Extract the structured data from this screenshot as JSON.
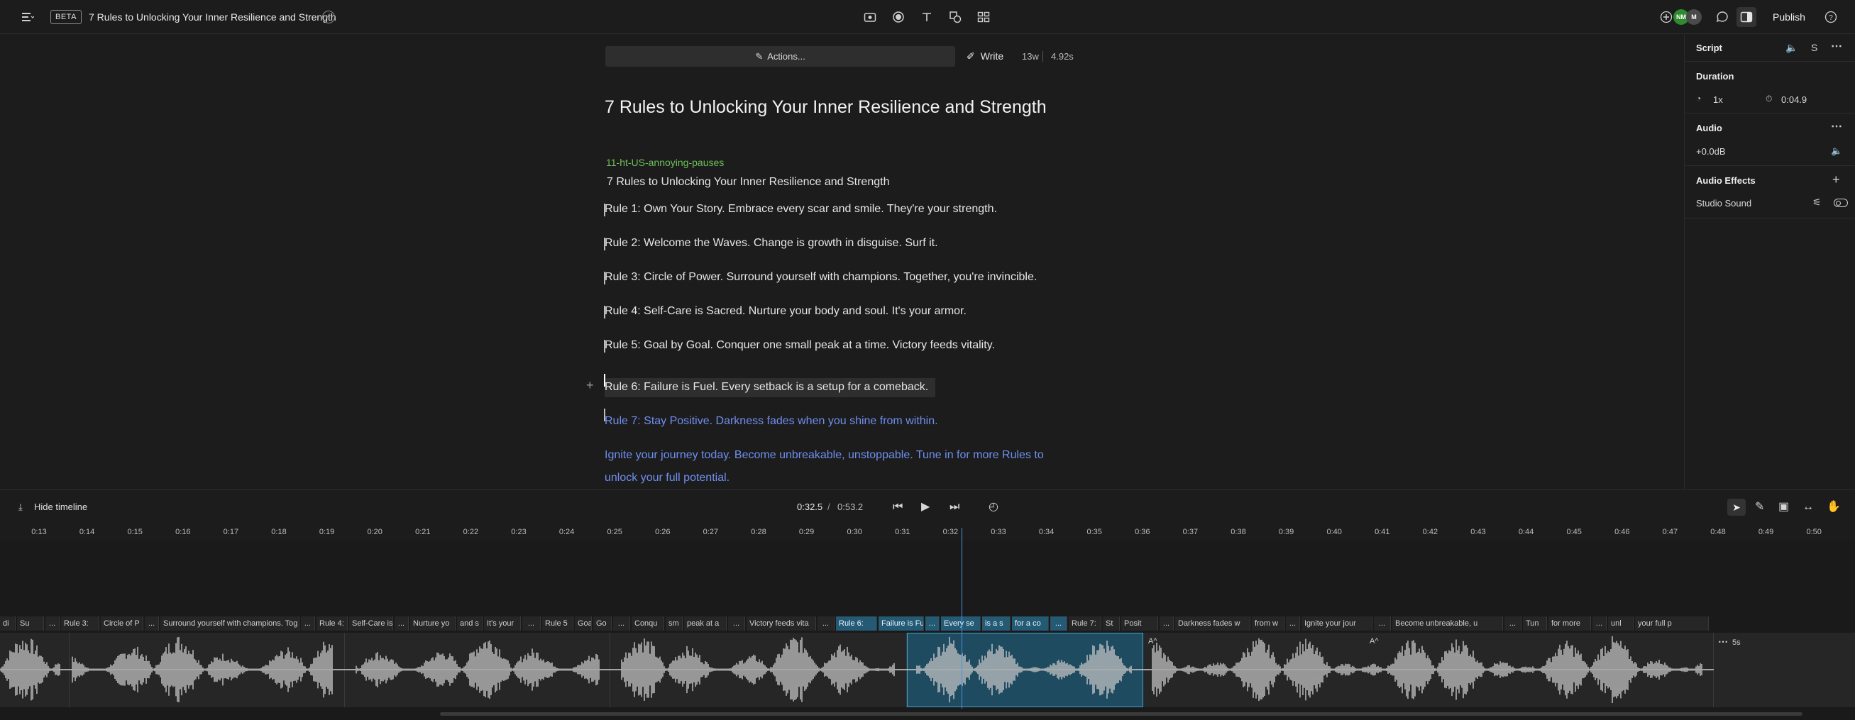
{
  "topbar": {
    "beta_label": "BETA",
    "title": "7 Rules to Unlocking Your Inner Resilience and Strength",
    "avatars": [
      {
        "initials": "NM",
        "color": "#2e8b2e"
      },
      {
        "initials": "M",
        "color": "#4a4a4a"
      }
    ],
    "publish_label": "Publish"
  },
  "editor": {
    "actions_label": "Actions...",
    "write_label": "Write",
    "word_count": "13w",
    "duration": "4.92s",
    "heading": "7 Rules to Unlocking Your Inner Resilience and Strength",
    "speaker": "11-ht-US-annoying-pauses",
    "lines": [
      "7 Rules to Unlocking Your Inner Resilience and Strength",
      "Rule 1: Own Your Story. Embrace every scar and smile. They're your strength.",
      "Rule 2: Welcome the Waves. Change is growth in disguise. Surf it.",
      "Rule 3: Circle of Power. Surround yourself with champions. Together, you're invincible.",
      "Rule 4: Self-Care is Sacred. Nurture your body and soul. It's your armor.",
      "Rule 5: Goal by Goal. Conquer one small peak at a time. Victory feeds vitality.",
      "Rule 6: Failure is Fuel. Every setback is a setup for a comeback.",
      "Rule 7: Stay Positive. Darkness fades when you shine from within.",
      "Ignite your journey today. Become unbreakable, unstoppable. Tune in for more Rules to",
      "unlock your full potential."
    ]
  },
  "panel": {
    "script_label": "Script",
    "script_shortcut": "S",
    "duration_label": "Duration",
    "speed": "1x",
    "duration_value": "0:04.9",
    "audio_label": "Audio",
    "gain": "+0.0dB",
    "effects_label": "Audio Effects",
    "studio_sound": "Studio Sound"
  },
  "timeline": {
    "hide_label": "Hide timeline",
    "current_time": "0:32.5",
    "separator": "/",
    "total_time": "0:53.2",
    "ticks": [
      "0:13",
      "0:14",
      "0:15",
      "0:16",
      "0:17",
      "0:18",
      "0:19",
      "0:20",
      "0:21",
      "0:22",
      "0:23",
      "0:24",
      "0:25",
      "0:26",
      "0:27",
      "0:28",
      "0:29",
      "0:30",
      "0:31",
      "0:32",
      "0:33",
      "0:34",
      "0:35",
      "0:36",
      "0:37",
      "0:38",
      "0:39",
      "0:40",
      "0:41",
      "0:42",
      "0:43",
      "0:44",
      "0:45",
      "0:46",
      "0:47",
      "0:48",
      "0:49",
      "0:50"
    ],
    "words": [
      "di",
      "Su",
      "...",
      "Rule 3:",
      "Circle of P",
      "...",
      "Surround yourself with champions. Tog",
      "...",
      "Rule 4:",
      "Self-Care is S",
      "...",
      "Nurture yo",
      "and s",
      "It's your",
      "...",
      "Rule 5",
      "Goa",
      "Go",
      "...",
      "Conqu",
      "sm",
      "peak at a",
      "...",
      "Victory feeds vita",
      "...",
      "Rule 6:",
      "Failure is Fu",
      "...",
      "Every se",
      "is a s",
      "for a co",
      "...",
      "Rule 7:",
      "St",
      "Posit",
      "...",
      "Darkness fades w",
      "from w",
      "...",
      "Ignite your jour",
      "...",
      "Become unbreakable, u",
      "...",
      "Tun",
      "for more",
      "...",
      "unl",
      "your full p"
    ],
    "end_label": "5s",
    "caption_marker": "A^"
  }
}
